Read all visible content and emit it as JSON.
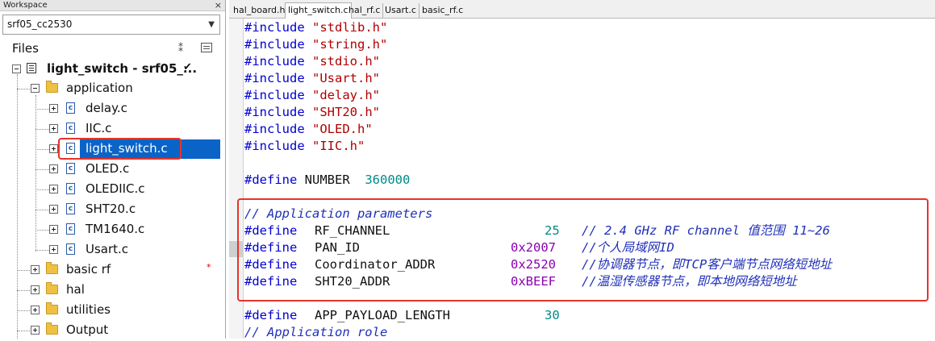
{
  "workspace": {
    "title": "Workspace",
    "close_glyph": "×",
    "config": "srf05_cc2530",
    "files_label": "Files"
  },
  "tree": {
    "project": {
      "label": "light_switch - srf05_...",
      "check": "✔"
    },
    "application": {
      "label": "application"
    },
    "files": [
      {
        "label": "delay.c"
      },
      {
        "label": "IIC.c"
      },
      {
        "label": "light_switch.c",
        "selected": true
      },
      {
        "label": "OLED.c"
      },
      {
        "label": "OLEDIIC.c"
      },
      {
        "label": "SHT20.c"
      },
      {
        "label": "TM1640.c"
      },
      {
        "label": "Usart.c"
      }
    ],
    "folders": [
      {
        "label": "basic rf",
        "marker": "*"
      },
      {
        "label": "hal"
      },
      {
        "label": "utilities"
      },
      {
        "label": "Output"
      }
    ]
  },
  "tabs": [
    {
      "label": "hal_board.h"
    },
    {
      "label": "light_switch.c",
      "active": true
    },
    {
      "label": "hal_rf.c"
    },
    {
      "label": "Usart.c"
    },
    {
      "label": "basic_rf.c"
    }
  ],
  "code": {
    "includes": [
      {
        "kw": "#include",
        "file": "\"stdlib.h\""
      },
      {
        "kw": "#include",
        "file": "\"string.h\""
      },
      {
        "kw": "#include",
        "file": "\"stdio.h\""
      },
      {
        "kw": "#include",
        "file": "\"Usart.h\""
      },
      {
        "kw": "#include",
        "file": "\"delay.h\""
      },
      {
        "kw": "#include",
        "file": "\"SHT20.h\""
      },
      {
        "kw": "#include",
        "file": "\"OLED.h\""
      },
      {
        "kw": "#include",
        "file": "\"IIC.h\""
      }
    ],
    "number_define": {
      "kw": "#define",
      "name": "NUMBER",
      "value": "360000"
    },
    "app_params_comment": "// Application parameters",
    "params": [
      {
        "kw": "#define",
        "name": "RF_CHANNEL",
        "value": "25",
        "comment": "// 2.4 GHz RF channel 值范围 11~26"
      },
      {
        "kw": "#define",
        "name": "PAN_ID",
        "value": "0x2007",
        "comment": "//个人局域网ID"
      },
      {
        "kw": "#define",
        "name": "Coordinator_ADDR",
        "value": "0x2520",
        "comment": "//协调器节点，即TCP客户端节点网络短地址"
      },
      {
        "kw": "#define",
        "name": "SHT20_ADDR",
        "value": "0xBEEF",
        "comment": "//温湿传感器节点，即本地网络短地址"
      }
    ],
    "payload_define": {
      "kw": "#define",
      "name": "APP_PAYLOAD_LENGTH",
      "value": "30"
    },
    "role_comment": "// Application role"
  },
  "colors": {
    "keyword": "#0000d0",
    "string": "#b00000",
    "number": "#008a8a",
    "hex": "#8a00b0",
    "comment": "#2030b8",
    "selection": "#0a64c8",
    "highlight_box": "#e8332a"
  }
}
